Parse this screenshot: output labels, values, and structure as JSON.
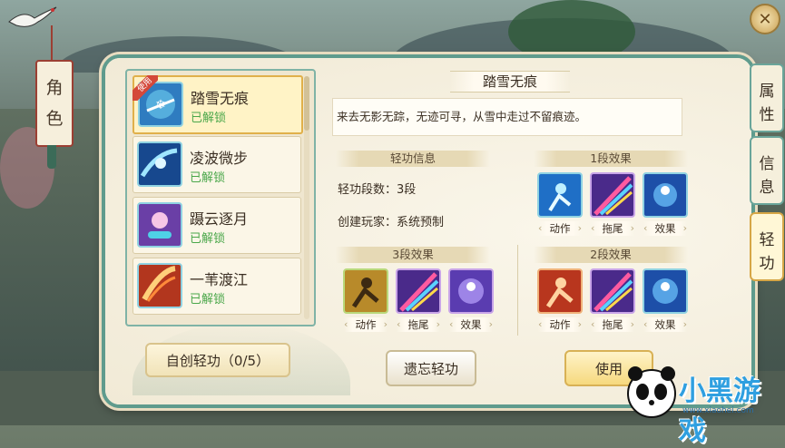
{
  "left_tab": {
    "line1": "角",
    "line2": "色"
  },
  "skill_list": [
    {
      "name": "踏雪无痕",
      "status": "已解锁",
      "badge": "使用",
      "selected": true
    },
    {
      "name": "凌波微步",
      "status": "已解锁",
      "selected": false
    },
    {
      "name": "蹑云逐月",
      "status": "已解锁",
      "selected": false
    },
    {
      "name": "一苇渡江",
      "status": "已解锁",
      "selected": false
    }
  ],
  "buttons": {
    "create": "自创轻功（0/5）",
    "forget": "遗忘轻功",
    "use": "使用"
  },
  "detail": {
    "title": "踏雪无痕",
    "description": "来去无影无踪，无迹可寻，从雪中走过不留痕迹。",
    "info_header": "轻功信息",
    "stage_count": "轻功段数：3段",
    "creator": "创建玩家：系统预制"
  },
  "effects": {
    "stage1": {
      "header": "1段效果",
      "labels": [
        "动作",
        "拖尾",
        "效果"
      ]
    },
    "stage2": {
      "header": "2段效果",
      "labels": [
        "动作",
        "拖尾",
        "效果"
      ]
    },
    "stage3": {
      "header": "3段效果",
      "labels": [
        "动作",
        "拖尾",
        "效果"
      ]
    }
  },
  "right_tabs": [
    {
      "line1": "属",
      "line2": "性",
      "active": false
    },
    {
      "line1": "信",
      "line2": "息",
      "active": false
    },
    {
      "line1": "轻",
      "line2": "功",
      "active": true
    }
  ],
  "logo": {
    "text": "小黑游戏",
    "sub": "www.xiaohei.com"
  },
  "colors": {
    "accent": "#5f9b8d",
    "unlocked": "#4aa74a",
    "badge": "#d4483a",
    "gold": "#d8b155"
  }
}
